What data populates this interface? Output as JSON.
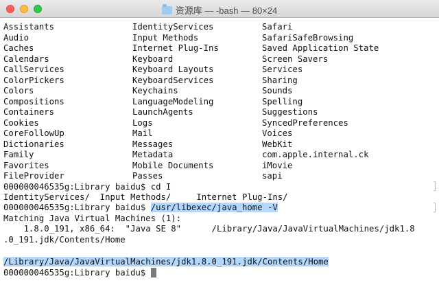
{
  "window": {
    "title": "资源库 — -bash — 80×24",
    "title_icon": "folder-icon"
  },
  "listing": [
    [
      "Assistants",
      "IdentityServices",
      "Safari"
    ],
    [
      "Audio",
      "Input Methods",
      "SafariSafeBrowsing"
    ],
    [
      "Caches",
      "Internet Plug-Ins",
      "Saved Application State"
    ],
    [
      "Calendars",
      "Keyboard",
      "Screen Savers"
    ],
    [
      "CallServices",
      "Keyboard Layouts",
      "Services"
    ],
    [
      "ColorPickers",
      "KeyboardServices",
      "Sharing"
    ],
    [
      "Colors",
      "Keychains",
      "Sounds"
    ],
    [
      "Compositions",
      "LanguageModeling",
      "Spelling"
    ],
    [
      "Containers",
      "LaunchAgents",
      "Suggestions"
    ],
    [
      "Cookies",
      "Logs",
      "SyncedPreferences"
    ],
    [
      "CoreFollowUp",
      "Mail",
      "Voices"
    ],
    [
      "Dictionaries",
      "Messages",
      "WebKit"
    ],
    [
      "Family",
      "Metadata",
      "com.apple.internal.ck"
    ],
    [
      "Favorites",
      "Mobile Documents",
      "iMovie"
    ],
    [
      "FileProvider",
      "Passes",
      "sapi"
    ]
  ],
  "session": {
    "prompt1": "000000046535g:Library baidu$ cd I",
    "completion": "IdentityServices/  Input Methods/     Internet Plug-Ins/",
    "prompt2": "000000046535g:Library baidu$ ",
    "command2": "/usr/libexec/java_home -V",
    "output1": "Matching Java Virtual Machines (1):",
    "output2": "    1.8.0_191, x86_64:  \"Java SE 8\"      /Library/Java/JavaVirtualMachines/jdk1.8",
    "output3": ".0_191.jdk/Contents/Home",
    "blank": "",
    "result": "/Library/Java/JavaVirtualMachines/jdk1.8.0_191.jdk/Contents/Home",
    "prompt3": "000000046535g:Library baidu$ "
  }
}
